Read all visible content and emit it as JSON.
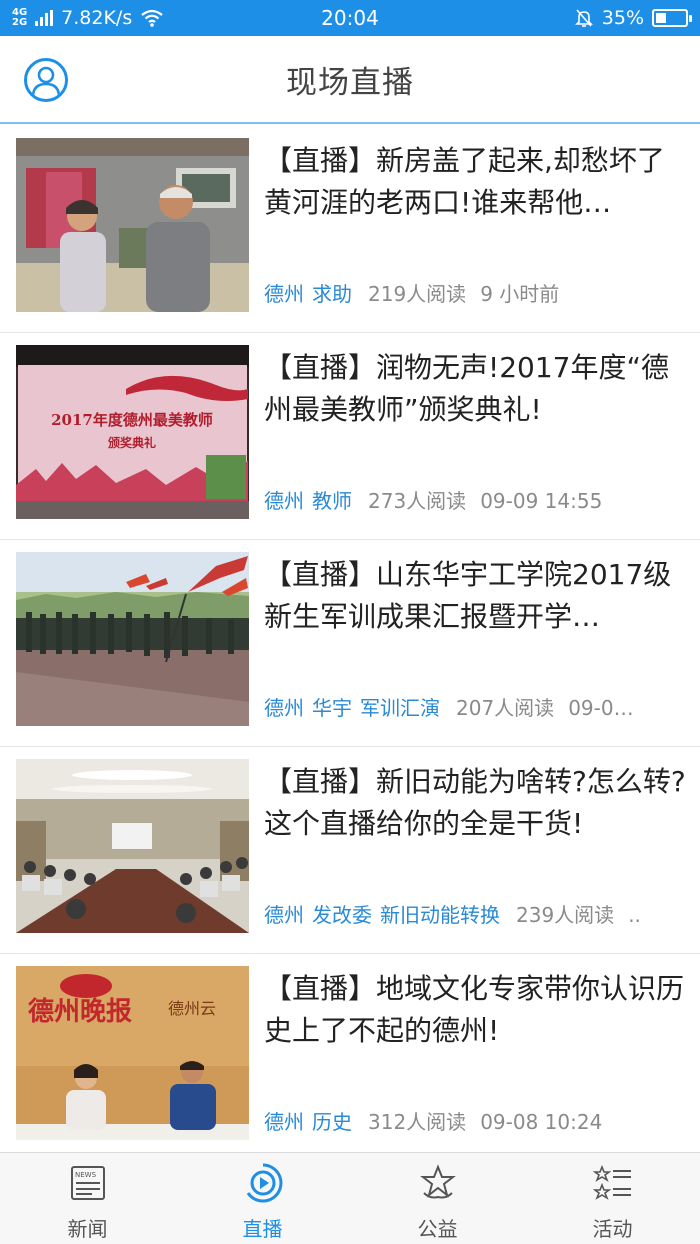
{
  "status_bar": {
    "net_top": "4G",
    "net_bottom": "2G",
    "speed": "7.82K/s",
    "time": "20:04",
    "battery": "35%",
    "battery_level": 0.35
  },
  "header": {
    "title": "现场直播"
  },
  "feed": [
    {
      "title": "【直播】新房盖了起来,却愁坏了黄河涯的老两口!谁来帮他…",
      "tags": [
        "德州",
        "求助"
      ],
      "reads": "219人阅读",
      "time": "9 小时前"
    },
    {
      "title": "【直播】润物无声!2017年度“德州最美教师”颁奖典礼!",
      "tags": [
        "德州",
        "教师"
      ],
      "reads": "273人阅读",
      "time": "09-09 14:55",
      "thumb_text": "2017年度德州最美教师",
      "thumb_sub": "颁奖典礼"
    },
    {
      "title": "【直播】山东华宇工学院2017级新生军训成果汇报暨开学…",
      "tags": [
        "德州",
        "华宇",
        "军训汇演"
      ],
      "reads": "207人阅读",
      "time": "09-0…"
    },
    {
      "title": "【直播】新旧动能为啥转?怎么转?这个直播给你的全是干货!",
      "tags": [
        "德州",
        "发改委",
        "新旧动能转换"
      ],
      "reads": "239人阅读",
      "time": ".."
    },
    {
      "title": "【直播】地域文化专家带你认识历史上了不起的德州!",
      "tags": [
        "德州",
        "历史"
      ],
      "reads": "312人阅读",
      "time": "09-08 10:24",
      "thumb_text": "德州晚报",
      "thumb_brand": "德州云"
    }
  ],
  "bottom_nav": [
    {
      "label": "新闻",
      "icon": "newspaper-icon",
      "active": false
    },
    {
      "label": "直播",
      "icon": "live-play-icon",
      "active": true
    },
    {
      "label": "公益",
      "icon": "charity-star-icon",
      "active": false
    },
    {
      "label": "活动",
      "icon": "activity-list-icon",
      "active": false
    }
  ],
  "colors": {
    "accent": "#1e8fe6",
    "tag": "#2a8ad6",
    "meta": "#8a8a8a"
  }
}
